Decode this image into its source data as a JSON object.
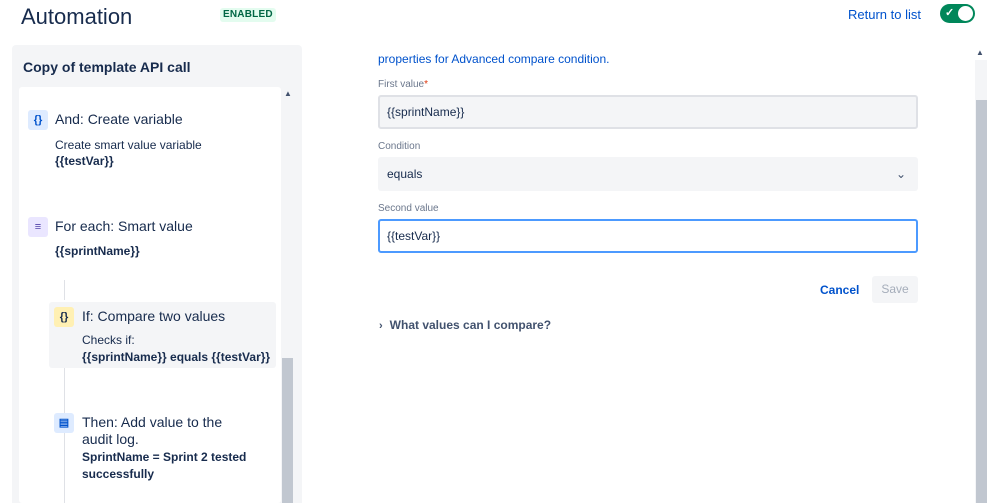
{
  "header": {
    "title": "Automation",
    "badge": "ENABLED",
    "return_link": "Return to list",
    "toggle_state": "on"
  },
  "rule_panel": {
    "title": "Copy of template API call",
    "steps": [
      {
        "icon": "braces-icon",
        "icon_glyph": "{}",
        "title": "And: Create variable",
        "desc": "Create smart value variable",
        "value": "{{testVar}}"
      },
      {
        "icon": "list-icon",
        "icon_glyph": "≡",
        "title": "For each: Smart value",
        "value": "{{sprintName}}"
      },
      {
        "icon": "braces-icon",
        "icon_glyph": "{}",
        "title": "If: Compare two values",
        "desc": "Checks if:",
        "value": "{{sprintName}} equals {{testVar}}"
      },
      {
        "icon": "audit-log-icon",
        "icon_glyph": "▤",
        "title_line1": "Then: Add value to the",
        "title_line2": "audit log.",
        "value_line1": "SprintName = Sprint 2 tested",
        "value_line2": "successfully"
      }
    ]
  },
  "form": {
    "intro_text": "properties for Advanced compare condition.",
    "first_value_label": "First value",
    "required_marker": "*",
    "first_value": "{{sprintName}}",
    "condition_label": "Condition",
    "condition_value": "equals",
    "second_value_label": "Second value",
    "second_value": "{{testVar}}",
    "cancel_label": "Cancel",
    "save_label": "Save",
    "help_toggle": "What values can I compare?"
  },
  "colors": {
    "accent": "#0052cc",
    "enabled_bg": "#e3fcef",
    "enabled_text": "#006644",
    "toggle_on": "#00875a",
    "focus_border": "#4c9aff"
  }
}
